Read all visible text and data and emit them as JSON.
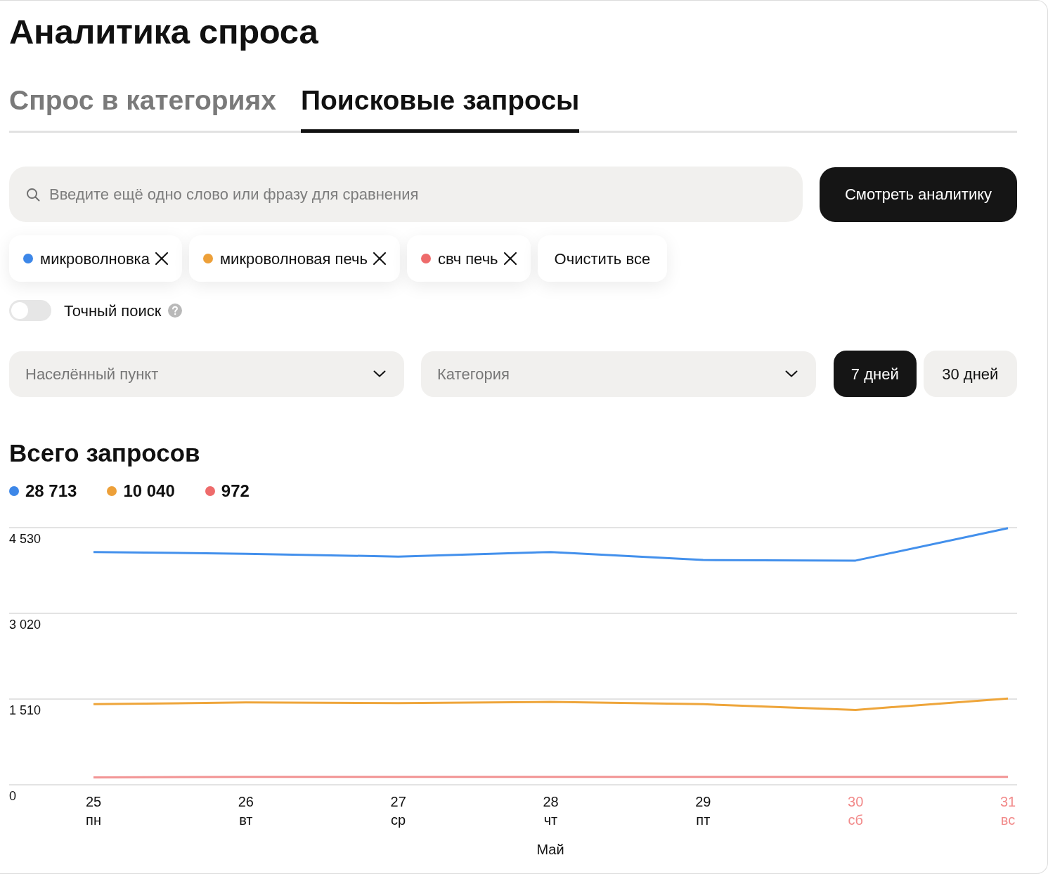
{
  "title": "Аналитика спроса",
  "tabs": [
    {
      "label": "Спрос в категориях",
      "selected": false
    },
    {
      "label": "Поисковые запросы",
      "selected": true
    }
  ],
  "search": {
    "placeholder": "Введите ещё одно слово или фразу для сравнения",
    "button": "Смотреть аналитику"
  },
  "queries": [
    {
      "text": "микроволновка",
      "color": "#3d87e8"
    },
    {
      "text": "микроволновая печь",
      "color": "#eda039"
    },
    {
      "text": "свч печь",
      "color": "#ee6b6b"
    }
  ],
  "clear_all": "Очистить все",
  "exact_search": {
    "label": "Точный поиск",
    "on": false
  },
  "filters": [
    {
      "placeholder": "Населённый пункт"
    },
    {
      "placeholder": "Категория"
    }
  ],
  "periods": [
    {
      "label": "7 дней",
      "selected": true
    },
    {
      "label": "30 дней",
      "selected": false
    }
  ],
  "summary": {
    "title": "Всего запросов",
    "totals": [
      {
        "value": "28 713",
        "color": "#3d87e8"
      },
      {
        "value": "10 040",
        "color": "#eda039"
      },
      {
        "value": "972",
        "color": "#ee6b6b"
      }
    ]
  },
  "chart": {
    "chart_data": {
      "type": "line",
      "xlabel": "Май",
      "categories": [
        "25",
        "26",
        "27",
        "28",
        "29",
        "30",
        "31"
      ],
      "series": [
        {
          "color": "#4390ec",
          "values": [
            4100,
            4070,
            4020,
            4100,
            3960,
            3950,
            4520
          ]
        },
        {
          "color": "#eea53a",
          "values": [
            1420,
            1450,
            1440,
            1460,
            1420,
            1320,
            1520
          ]
        },
        {
          "color": "#f29494",
          "values": [
            130,
            140,
            140,
            140,
            140,
            140,
            140
          ]
        }
      ],
      "ylim": [
        0,
        4530
      ],
      "yticks": [
        0,
        {
          "value": 1510,
          "label": "1 510"
        },
        {
          "value": 3020,
          "label": "3 020"
        },
        {
          "value": 4530,
          "label": "4 530"
        }
      ]
    },
    "weekdays": [
      {
        "label": "пн",
        "weekend": false
      },
      {
        "label": "вт",
        "weekend": false
      },
      {
        "label": "ср",
        "weekend": false
      },
      {
        "label": "чт",
        "weekend": false
      },
      {
        "label": "пт",
        "weekend": false
      },
      {
        "label": "сб",
        "weekend": true
      },
      {
        "label": "вс",
        "weekend": true
      }
    ]
  }
}
